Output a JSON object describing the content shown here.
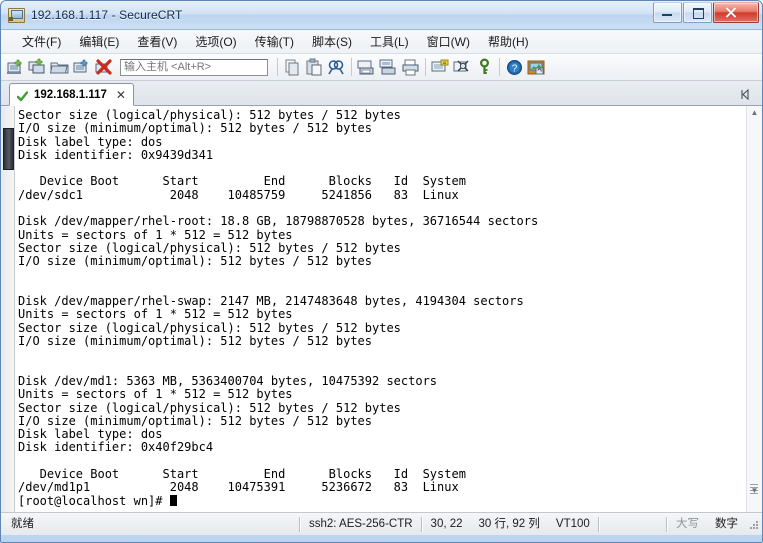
{
  "window": {
    "title": "192.168.1.117 - SecureCRT",
    "icon": "securecrt-icon",
    "minimize_label": "–",
    "maximize_label": "□",
    "close_label": "✕"
  },
  "menubar": {
    "items": [
      {
        "label": "文件(F)",
        "name": "menu-file"
      },
      {
        "label": "编辑(E)",
        "name": "menu-edit"
      },
      {
        "label": "查看(V)",
        "name": "menu-view"
      },
      {
        "label": "选项(O)",
        "name": "menu-options"
      },
      {
        "label": "传输(T)",
        "name": "menu-transfer"
      },
      {
        "label": "脚本(S)",
        "name": "menu-script"
      },
      {
        "label": "工具(L)",
        "name": "menu-tools"
      },
      {
        "label": "窗口(W)",
        "name": "menu-window"
      },
      {
        "label": "帮助(H)",
        "name": "menu-help"
      }
    ]
  },
  "toolbar": {
    "host_placeholder": "输入主机 <Alt+R>",
    "host_value": "",
    "icons": [
      "new-session-icon",
      "clone-session-icon",
      "open-session-icon",
      "connect-sftp-icon",
      "disconnect-icon",
      "copy-icon",
      "paste-icon",
      "find-icon",
      "print-screen-icon",
      "log-session-icon",
      "print-icon",
      "session-options-icon",
      "global-options-icon",
      "key-icon",
      "help-icon",
      "transfer-window-icon"
    ]
  },
  "tabbar": {
    "tabs": [
      {
        "label": "192.168.1.117",
        "status_icon": "connected-check-icon",
        "close_label": "✕"
      }
    ],
    "scroll_left_icon": "scroll-left-icon"
  },
  "terminal": {
    "lines": [
      "Sector size (logical/physical): 512 bytes / 512 bytes",
      "I/O size (minimum/optimal): 512 bytes / 512 bytes",
      "Disk label type: dos",
      "Disk identifier: 0x9439d341",
      "",
      "   Device Boot      Start         End      Blocks   Id  System",
      "/dev/sdc1            2048    10485759     5241856   83  Linux",
      "",
      "Disk /dev/mapper/rhel-root: 18.8 GB, 18798870528 bytes, 36716544 sectors",
      "Units = sectors of 1 * 512 = 512 bytes",
      "Sector size (logical/physical): 512 bytes / 512 bytes",
      "I/O size (minimum/optimal): 512 bytes / 512 bytes",
      "",
      "",
      "Disk /dev/mapper/rhel-swap: 2147 MB, 2147483648 bytes, 4194304 sectors",
      "Units = sectors of 1 * 512 = 512 bytes",
      "Sector size (logical/physical): 512 bytes / 512 bytes",
      "I/O size (minimum/optimal): 512 bytes / 512 bytes",
      "",
      "",
      "Disk /dev/md1: 5363 MB, 5363400704 bytes, 10475392 sectors",
      "Units = sectors of 1 * 512 = 512 bytes",
      "Sector size (logical/physical): 512 bytes / 512 bytes",
      "I/O size (minimum/optimal): 512 bytes / 512 bytes",
      "Disk label type: dos",
      "Disk identifier: 0x40f29bc4",
      "",
      "   Device Boot      Start         End      Blocks   Id  System",
      "/dev/md1p1           2048    10475391     5236672   83  Linux"
    ],
    "prompt": "[root@localhost wn]# ",
    "cursor": "block-cursor"
  },
  "statusbar": {
    "ready": "就绪",
    "protocol": "ssh2: AES-256-CTR",
    "cursor_pos": "30, 22",
    "dimensions": "30 行, 92 列",
    "emulation": "VT100",
    "caps": "大写",
    "num": "数字",
    "resize_grip": "resize-grip-icon"
  }
}
